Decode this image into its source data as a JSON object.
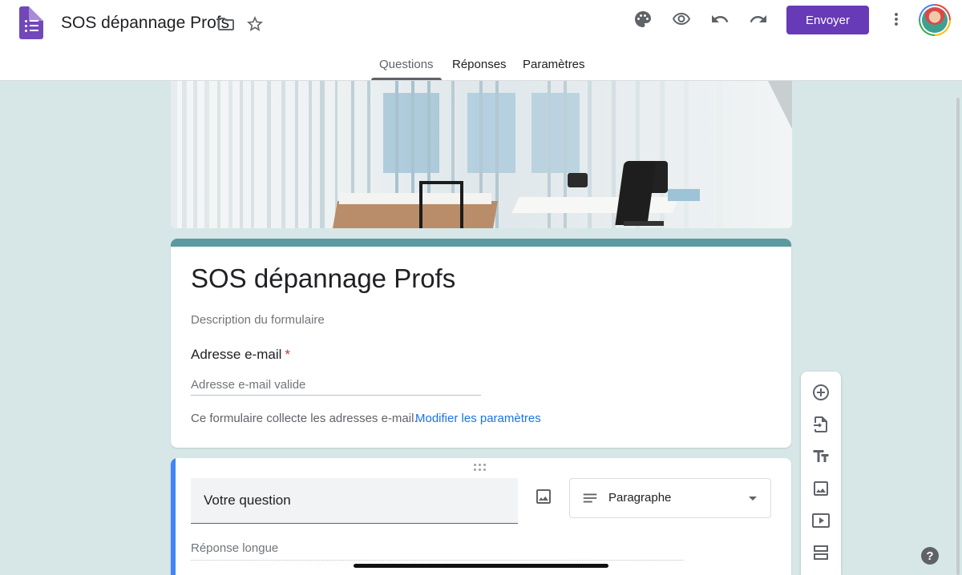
{
  "app": {
    "title": "SOS dépannage Profs",
    "send_label": "Envoyer",
    "accent_color": "#673ab7"
  },
  "toolbar_icons": [
    "folder-icon",
    "star-icon",
    "palette-icon",
    "preview-eye-icon",
    "undo-icon",
    "redo-icon",
    "more-vert-icon"
  ],
  "tabs": [
    {
      "label": "Questions",
      "active": true
    },
    {
      "label": "Réponses",
      "active": false
    },
    {
      "label": "Paramètres",
      "active": false
    }
  ],
  "form": {
    "title": "SOS dépannage Profs",
    "description_placeholder": "Description du formulaire",
    "email_label": "Adresse e-mail",
    "required_mark": "*",
    "email_placeholder": "Adresse e-mail valide",
    "collect_note": "Ce formulaire collecte les adresses e-mail.",
    "settings_link": "Modifier les paramètres",
    "theme_color": "#5b9a9e"
  },
  "question": {
    "title_placeholder": "Votre question",
    "type_label": "Paragraphe",
    "answer_placeholder": "Réponse longue",
    "accent_color": "#4285f4"
  },
  "floating_tools": [
    "add-question-icon",
    "import-questions-icon",
    "add-title-icon",
    "add-image-icon",
    "add-video-icon",
    "add-section-icon"
  ],
  "help_label": "?"
}
